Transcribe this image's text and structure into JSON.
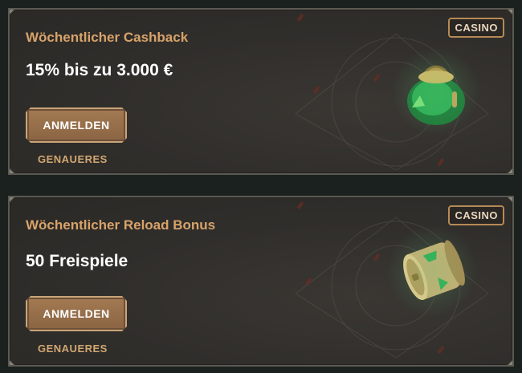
{
  "promos": [
    {
      "title": "Wöchentlicher Cashback",
      "amount": "15% bis zu 3.000 €",
      "badge": "CASINO",
      "button_label": "ANMELDEN",
      "details_label": "GENAUERES",
      "icon": "money-bag-icon"
    },
    {
      "title": "Wöchentlicher Reload Bonus",
      "amount": "50 Freispiele",
      "badge": "CASINO",
      "button_label": "ANMELDEN",
      "details_label": "GENAUERES",
      "icon": "slot-reel-icon"
    }
  ],
  "colors": {
    "title": "#d8a36a",
    "button": "#a37a52",
    "accent_green": "#2fae55"
  }
}
